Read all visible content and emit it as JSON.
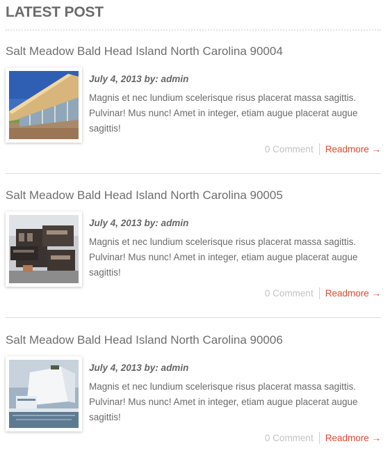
{
  "section": {
    "title": "LATEST POST"
  },
  "posts": [
    {
      "title": "Salt Meadow Bald Head Island North Carolina 90004",
      "meta": "July 4, 2013 by: admin",
      "excerpt": "Magnis et nec lundium scelerisque risus placerat massa sagittis. Pulvinar! Mus nunc! Amet in integer, etiam augue placerat augue sagittis!",
      "comments": "0 Comment",
      "readmore": "Readmore →"
    },
    {
      "title": "Salt Meadow Bald Head Island North Carolina 90005",
      "meta": "July 4, 2013 by: admin",
      "excerpt": "Magnis et nec lundium scelerisque risus placerat massa sagittis. Pulvinar! Mus nunc! Amet in integer, etiam augue placerat augue sagittis!",
      "comments": "0 Comment",
      "readmore": "Readmore →"
    },
    {
      "title": "Salt Meadow Bald Head Island North Carolina 90006",
      "meta": "July 4, 2013 by: admin",
      "excerpt": "Magnis et nec lundium scelerisque risus placerat massa sagittis. Pulvinar! Mus nunc! Amet in integer, etiam augue placerat augue sagittis!",
      "comments": "0 Comment",
      "readmore": "Readmore →"
    }
  ],
  "colors": {
    "accent": "#e04a2f",
    "muted": "#c2c2c2",
    "text": "#6a6a6a"
  }
}
